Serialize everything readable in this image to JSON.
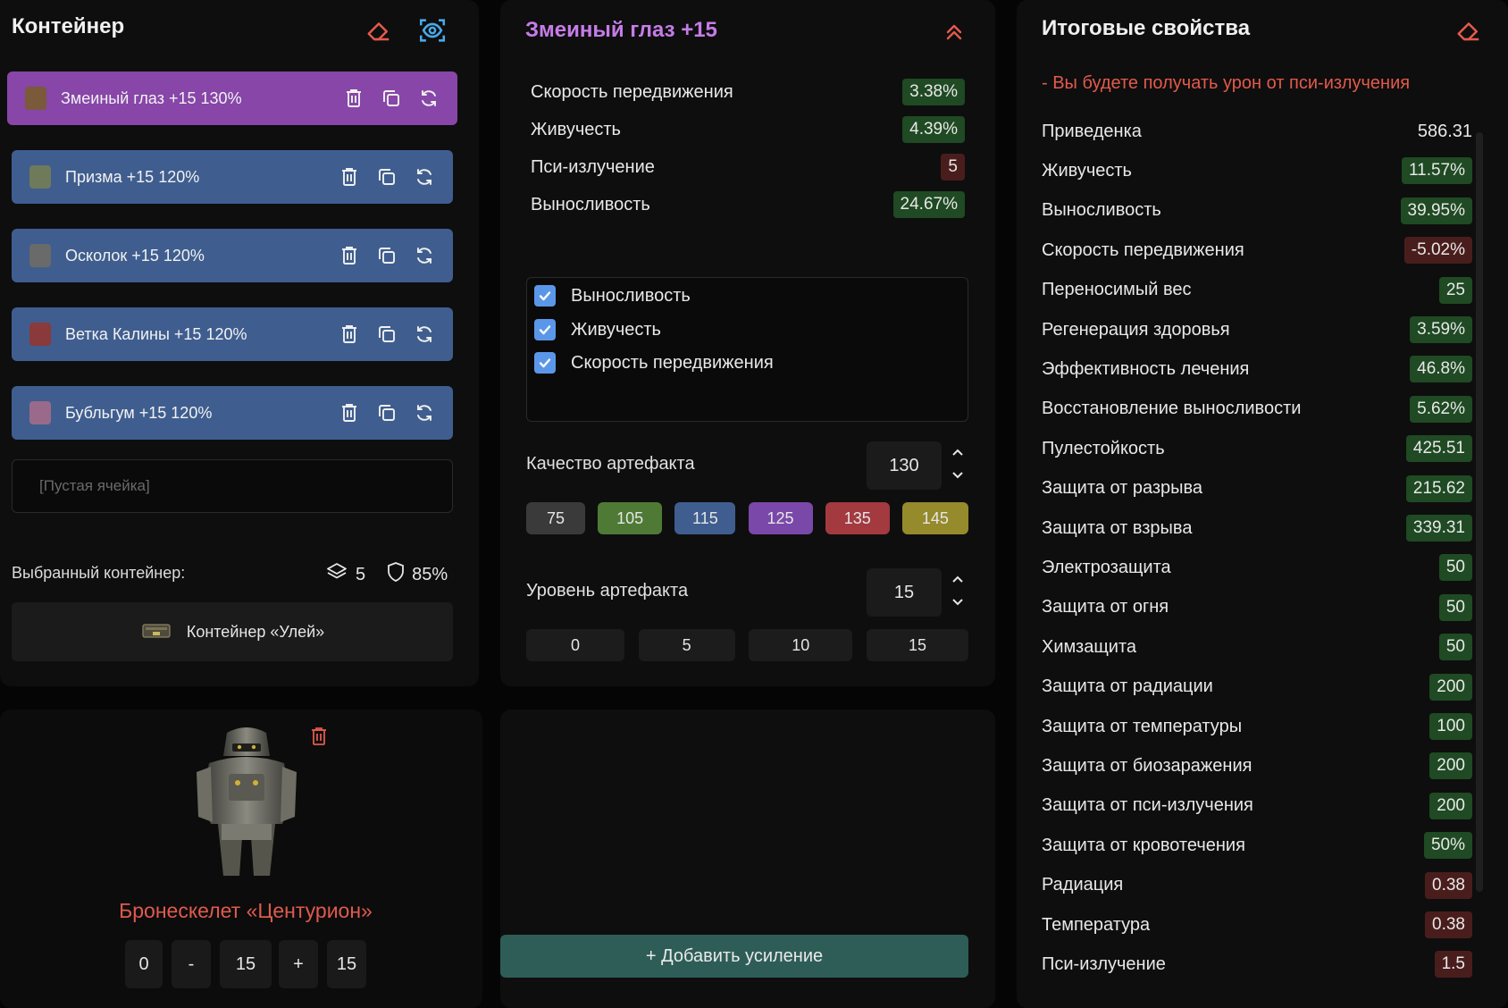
{
  "container_panel": {
    "title": "Контейнер",
    "slots": [
      {
        "name": "Змеиный глаз",
        "level": "+15",
        "quality": "130%",
        "active": true,
        "thumb_color": "#7a5a3a"
      },
      {
        "name": "Призма",
        "level": "+15",
        "quality": "120%",
        "active": false,
        "thumb_color": "#6f7a5a"
      },
      {
        "name": "Осколок",
        "level": "+15",
        "quality": "120%",
        "active": false,
        "thumb_color": "#6a6a6a"
      },
      {
        "name": "Ветка Калины",
        "level": "+15",
        "quality": "120%",
        "active": false,
        "thumb_color": "#8a3a3a"
      },
      {
        "name": "Бубльгум",
        "level": "+15",
        "quality": "120%",
        "active": false,
        "thumb_color": "#9a6a8a"
      }
    ],
    "empty_slot": "[Пустая ячейка]",
    "selected_label": "Выбранный контейнер:",
    "selected_capacity": "5",
    "selected_protection": "85%",
    "container_name": "Контейнер «Улей»"
  },
  "artifact_panel": {
    "title": "Змеиный глаз +15",
    "stats": [
      {
        "label": "Скорость передвижения",
        "value": "3.38%",
        "tone": "g"
      },
      {
        "label": "Живучесть",
        "value": "4.39%",
        "tone": "g"
      },
      {
        "label": "Пси-излучение",
        "value": "5",
        "tone": "r"
      },
      {
        "label": "Выносливость",
        "value": "24.67%",
        "tone": "g"
      }
    ],
    "checkboxes": [
      {
        "label": "Выносливость",
        "checked": true
      },
      {
        "label": "Живучесть",
        "checked": true
      },
      {
        "label": "Скорость передвижения",
        "checked": true
      }
    ],
    "quality_label": "Качество артефакта",
    "quality_value": "130",
    "quality_presets": [
      {
        "value": "75",
        "color": "#3a3a3a"
      },
      {
        "value": "105",
        "color": "#4e7a35"
      },
      {
        "value": "115",
        "color": "#3f5e8f"
      },
      {
        "value": "125",
        "color": "#7a48a8"
      },
      {
        "value": "135",
        "color": "#a23a40"
      },
      {
        "value": "145",
        "color": "#958a2c"
      }
    ],
    "level_label": "Уровень артефакта",
    "level_value": "15",
    "level_presets": [
      "0",
      "5",
      "10",
      "15"
    ]
  },
  "armor_panel": {
    "name": "Бронескелет «Центурион»",
    "min": "0",
    "minus": "-",
    "value": "15",
    "plus": "+",
    "max": "15"
  },
  "boost_panel": {
    "add_label": "+ Добавить усиление"
  },
  "summary_panel": {
    "title": "Итоговые свойства",
    "warning": "- Вы будете получать урон от пси-излучения",
    "rows": [
      {
        "label": "Приведенка",
        "value": "586.31",
        "tone": "none"
      },
      {
        "label": "Живучесть",
        "value": "11.57%",
        "tone": "g"
      },
      {
        "label": "Выносливость",
        "value": "39.95%",
        "tone": "g"
      },
      {
        "label": "Скорость передвижения",
        "value": "-5.02%",
        "tone": "r"
      },
      {
        "label": "Переносимый вес",
        "value": "25",
        "tone": "g"
      },
      {
        "label": "Регенерация здоровья",
        "value": "3.59%",
        "tone": "g"
      },
      {
        "label": "Эффективность лечения",
        "value": "46.8%",
        "tone": "g"
      },
      {
        "label": "Восстановление выносливости",
        "value": "5.62%",
        "tone": "g"
      },
      {
        "label": "Пулестойкость",
        "value": "425.51",
        "tone": "g"
      },
      {
        "label": "Защита от разрыва",
        "value": "215.62",
        "tone": "g"
      },
      {
        "label": "Защита от взрыва",
        "value": "339.31",
        "tone": "g"
      },
      {
        "label": "Электрозащита",
        "value": "50",
        "tone": "g"
      },
      {
        "label": "Защита от огня",
        "value": "50",
        "tone": "g"
      },
      {
        "label": "Химзащита",
        "value": "50",
        "tone": "g"
      },
      {
        "label": "Защита от радиации",
        "value": "200",
        "tone": "g"
      },
      {
        "label": "Защита от температуры",
        "value": "100",
        "tone": "g"
      },
      {
        "label": "Защита от биозаражения",
        "value": "200",
        "tone": "g"
      },
      {
        "label": "Защита от пси-излучения",
        "value": "200",
        "tone": "g"
      },
      {
        "label": "Защита от кровотечения",
        "value": "50%",
        "tone": "g"
      },
      {
        "label": "Радиация",
        "value": "0.38",
        "tone": "r"
      },
      {
        "label": "Температура",
        "value": "0.38",
        "tone": "r"
      },
      {
        "label": "Пси-излучение",
        "value": "1.5",
        "tone": "r"
      }
    ]
  },
  "colors": {
    "accent_red": "#e35a4c",
    "accent_blue": "#4aa8e8",
    "purple_title": "#c67ce8",
    "slot_blue": "#3f5e8f",
    "slot_purple": "#8746a8"
  }
}
